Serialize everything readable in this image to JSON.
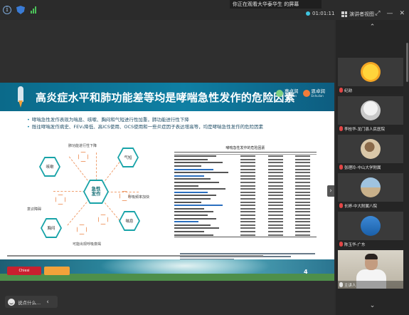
{
  "topbar": {
    "share_banner": "你正在观看大华泰华生 的屏幕",
    "rec_label": "01:01:11",
    "view_label": "演讲者视图",
    "controls": [
      "⤢",
      "—",
      "✕"
    ]
  },
  "slide": {
    "title": "高炎症水平和肺功能差等均是哮喘急性发作的危险因素",
    "logo1": "惠卓润",
    "logo1_sub": "Luhuilan",
    "logo2": "恩卓润",
    "logo2_sub": "Enhuilan",
    "bullets": [
      "哮喘急性发作表现为喘息、咳嗽、胸闷和气短进行性加重，肺功能进行性下降",
      "既往哮喘发作病史、FEV₁降低、高ICS使用、OCS使用和一些炎症因子表达增高等，均是哮喘急性发作的危险因素"
    ],
    "diagram": {
      "center": "急性\n发作",
      "nodes": [
        "咳嗽",
        "气短",
        "喘息",
        "胸闷"
      ],
      "annotations": [
        "肺功能进行性下降",
        "呼吸频率加快",
        "意识障碍",
        "可能出现呼吸衰竭"
      ]
    },
    "table_caption": "哮喘急性发作的危险因素",
    "table_header": [
      "",
      "",
      "",
      ""
    ],
    "page_number": "4",
    "brand": "Chiesi"
  },
  "toolbar": {
    "label": "说点什么..."
  },
  "participants": [
    {
      "name": "纪勋",
      "avatar": "sun",
      "muted": true
    },
    {
      "name": "李桂华-龙门县人民医院",
      "avatar": "person1",
      "muted": true
    },
    {
      "name": "张理玲-中山大学附属",
      "avatar": "bird",
      "muted": true
    },
    {
      "name": "长婷-中大附属八院",
      "avatar": "beach",
      "muted": true
    },
    {
      "name": "陈玉华-广东",
      "avatar": "tower",
      "muted": true
    },
    {
      "name": "主讲人",
      "avatar": "video",
      "muted": false
    }
  ]
}
